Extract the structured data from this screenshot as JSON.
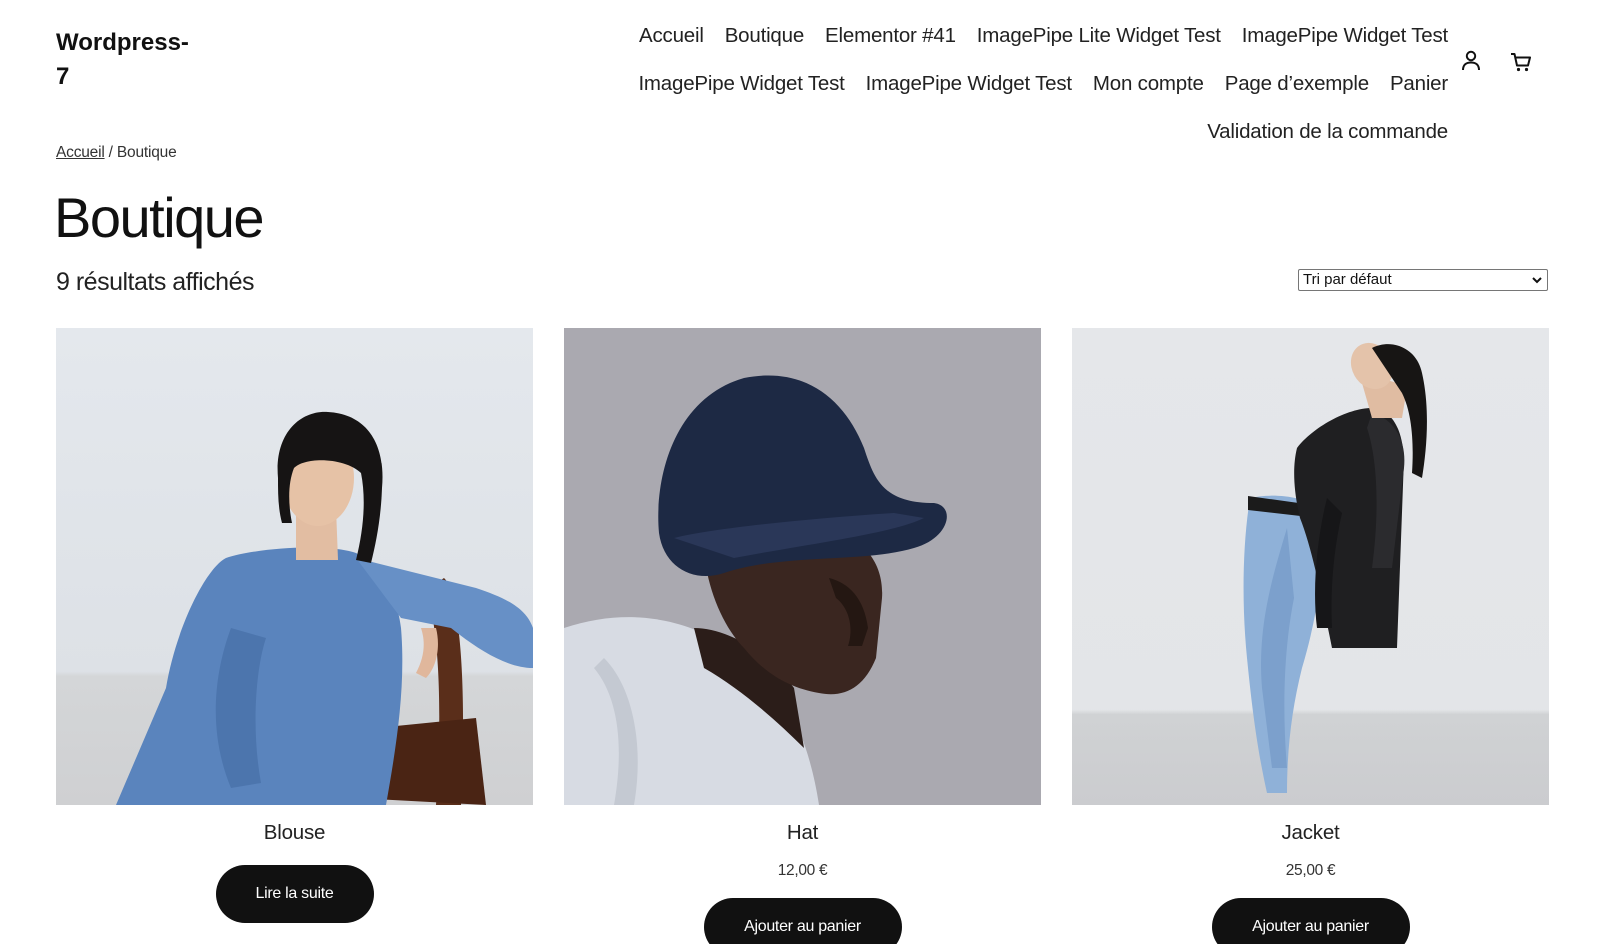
{
  "site": {
    "title_line1": "Wordpress-",
    "title_line2": "7"
  },
  "nav": {
    "items": [
      "Accueil",
      "Boutique",
      "Elementor #41",
      "ImagePipe Lite Widget Test",
      "ImagePipe Widget Test",
      "ImagePipe Widget Test",
      "ImagePipe Widget Test",
      "Mon compte",
      "Page d’exemple",
      "Panier",
      "Validation de la commande"
    ],
    "account_icon": "person-icon",
    "cart_icon": "cart-icon"
  },
  "breadcrumb": {
    "home": "Accueil",
    "separator": " / ",
    "current": "Boutique"
  },
  "page": {
    "title": "Boutique",
    "result_count": "9 résultats affichés"
  },
  "sort": {
    "selected": "Tri par défaut"
  },
  "products": [
    {
      "name": "Blouse",
      "price": "",
      "button": "Lire la suite"
    },
    {
      "name": "Hat",
      "price": "12,00 €",
      "button": "Ajouter au panier"
    },
    {
      "name": "Jacket",
      "price": "25,00 €",
      "button": "Ajouter au panier"
    }
  ],
  "colors": {
    "button_bg": "#111111",
    "text": "#111111",
    "background": "#ffffff"
  }
}
